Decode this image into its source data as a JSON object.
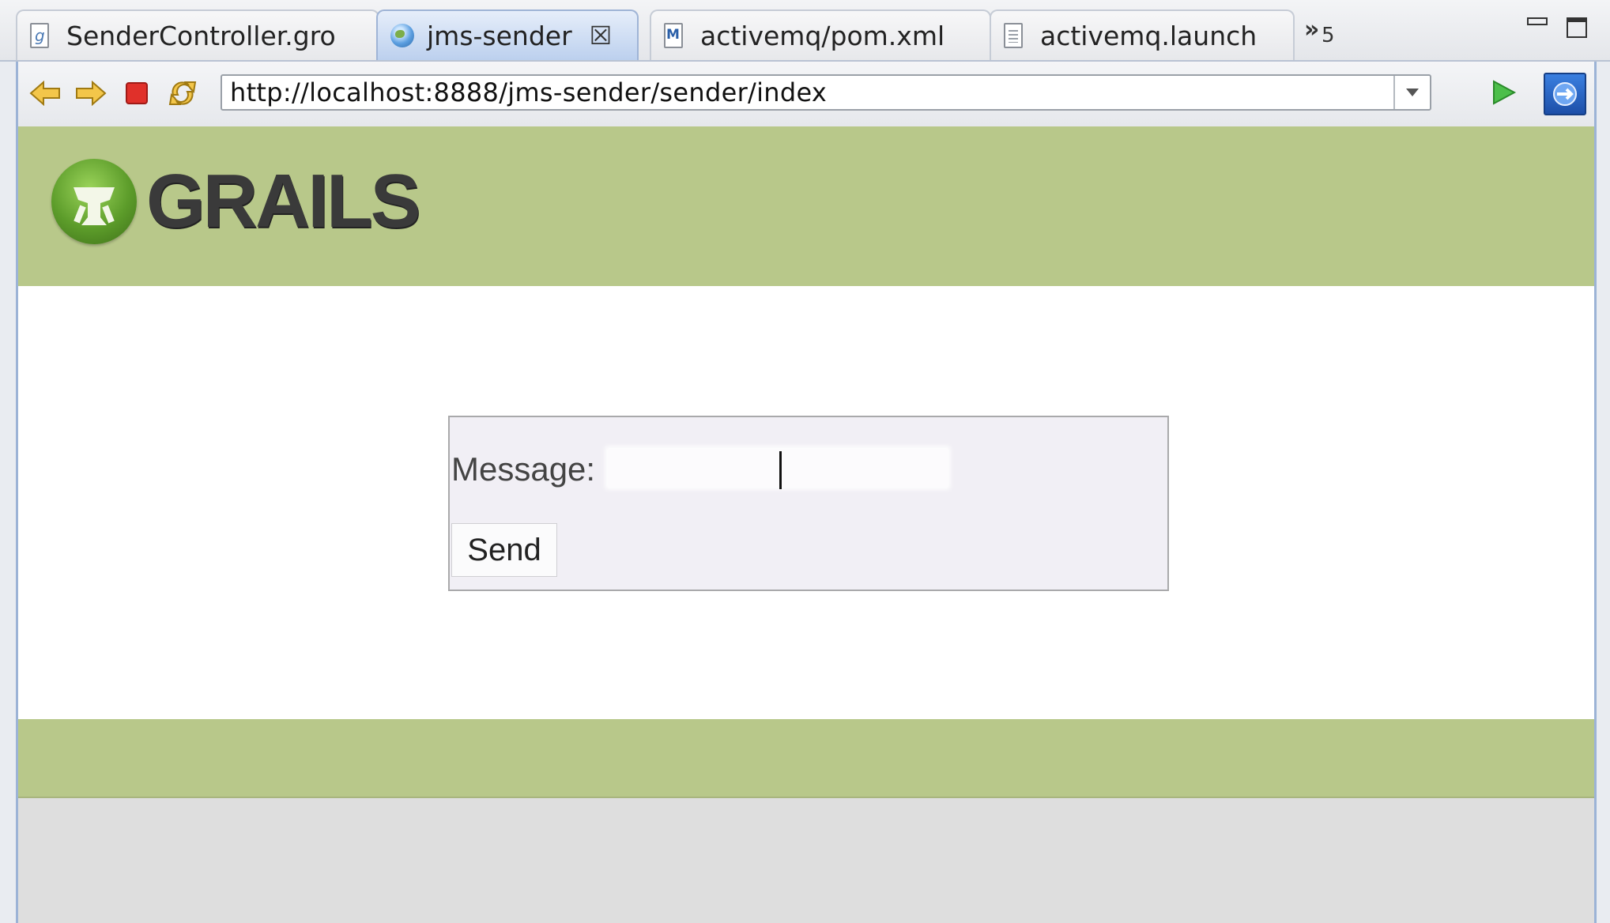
{
  "window": {
    "tabs": [
      {
        "label": "SenderController.gro",
        "icon": "groovy-file-icon",
        "active": false
      },
      {
        "label": "jms-sender",
        "icon": "globe-icon",
        "active": true,
        "close_glyph": "☒"
      },
      {
        "label": "activemq/pom.xml",
        "icon": "maven-file-icon",
        "active": false
      },
      {
        "label": "activemq.launch",
        "icon": "file-icon",
        "active": false
      }
    ],
    "overflow_chevron": "»",
    "overflow_count": "5",
    "minimize_icon": "minimize-icon",
    "maximize_icon": "maximize-icon"
  },
  "browser": {
    "url": "http://localhost:8888/jms-sender/sender/index",
    "buttons": [
      "back-arrow-icon",
      "forward-arrow-icon",
      "stop-icon",
      "refresh-icon",
      "go-icon",
      "external-browser-icon"
    ]
  },
  "page": {
    "logo_text": "GRAILS",
    "form": {
      "message_label": "Message:",
      "message_value": "",
      "send_label": "Send"
    }
  },
  "colors": {
    "header_green": "#b8c88a",
    "active_tab": "#bcd0ee",
    "stop_red": "#e0302a",
    "arrow_yellow": "#f3c64a"
  }
}
